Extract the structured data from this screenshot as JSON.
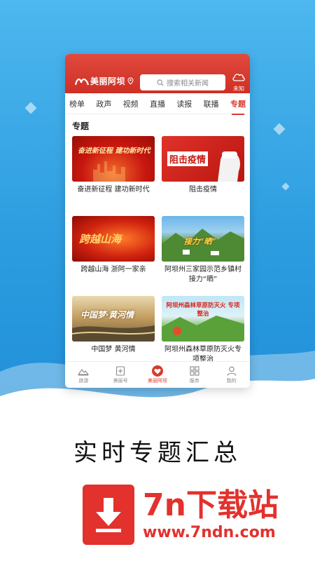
{
  "app": {
    "logo_text": "美丽阿坝",
    "search_placeholder": "搜索相关新闻",
    "weather_label": "未知"
  },
  "tabs": [
    {
      "label": "榜单"
    },
    {
      "label": "政声"
    },
    {
      "label": "视频"
    },
    {
      "label": "直播"
    },
    {
      "label": "读报"
    },
    {
      "label": "联播"
    },
    {
      "label": "专题"
    }
  ],
  "active_tab": "专题",
  "section": {
    "title": "专题"
  },
  "cards": [
    {
      "title": "奋进新征程 建功新时代",
      "thumb_text": "奋进新征程 建功新时代"
    },
    {
      "title": "阻击疫情",
      "thumb_text": "阻击疫情"
    },
    {
      "title": "跨越山海 浙阿一家亲",
      "thumb_text": "跨越山海"
    },
    {
      "title": "阿坝州三家园示范乡镇村接力“晒”",
      "thumb_text": "接力“晒”"
    },
    {
      "title": "中国梦 黄河情",
      "thumb_text": "中国梦·黄河情"
    },
    {
      "title": "阿坝州森林草原防灭火专项整治",
      "thumb_text": "阿坝州森林草原防灭火 专项整治"
    }
  ],
  "bottom_nav": [
    {
      "label": "旅游",
      "icon": "mountain-icon"
    },
    {
      "label": "美丽号",
      "icon": "plus-doc-icon"
    },
    {
      "label": "美丽阿坝",
      "icon": "heart-icon"
    },
    {
      "label": "服务",
      "icon": "grid-icon"
    },
    {
      "label": "我的",
      "icon": "person-icon"
    }
  ],
  "caption": "实时专题汇总",
  "watermark": {
    "title": "7n下载站",
    "url": "www.7ndn.com"
  },
  "colors": {
    "brand_red": "#d93a2e",
    "sky_blue": "#2d9de0",
    "watermark_red": "#e3312d"
  }
}
